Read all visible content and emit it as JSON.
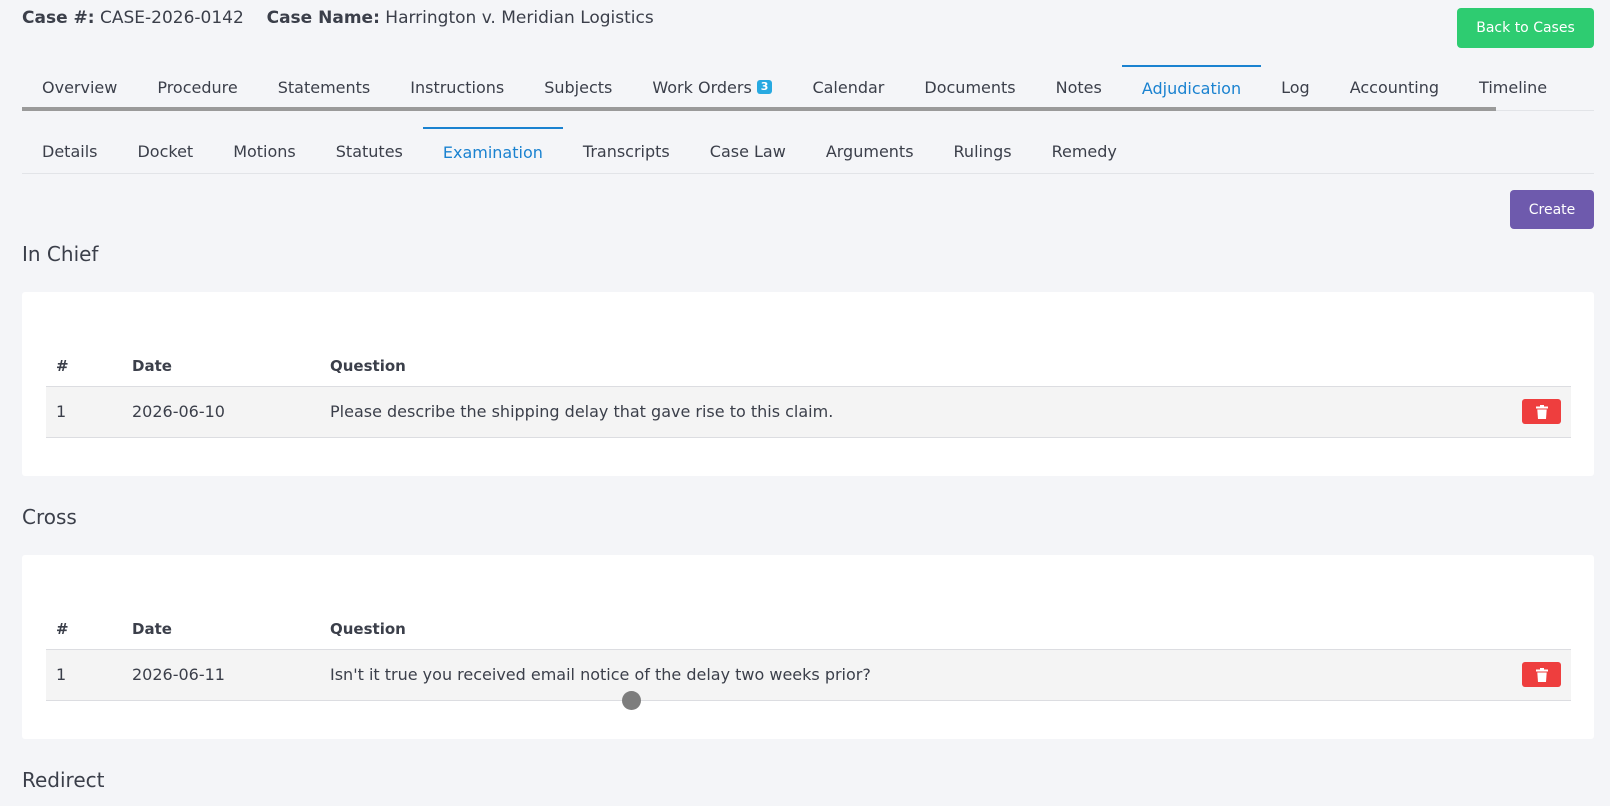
{
  "header": {
    "case_number_label": "Case #:",
    "case_number": "CASE-2026-0142",
    "case_name_label": "Case Name:",
    "case_name": "Harrington v. Meridian Logistics",
    "back_button": "Back to Cases"
  },
  "tabs": [
    {
      "label": "Overview"
    },
    {
      "label": "Procedure"
    },
    {
      "label": "Statements"
    },
    {
      "label": "Instructions"
    },
    {
      "label": "Subjects"
    },
    {
      "label": "Work Orders",
      "badge": "3"
    },
    {
      "label": "Calendar"
    },
    {
      "label": "Documents"
    },
    {
      "label": "Notes"
    },
    {
      "label": "Adjudication",
      "active": true
    },
    {
      "label": "Log"
    },
    {
      "label": "Accounting"
    },
    {
      "label": "Timeline"
    }
  ],
  "subtabs": [
    {
      "label": "Details"
    },
    {
      "label": "Docket"
    },
    {
      "label": "Motions"
    },
    {
      "label": "Statutes"
    },
    {
      "label": "Examination",
      "active": true
    },
    {
      "label": "Transcripts"
    },
    {
      "label": "Case Law"
    },
    {
      "label": "Arguments"
    },
    {
      "label": "Rulings"
    },
    {
      "label": "Remedy"
    }
  ],
  "create_button": "Create",
  "columns": {
    "num": "#",
    "date": "Date",
    "question": "Question"
  },
  "sections": {
    "in_chief": {
      "title": "In Chief",
      "rows": [
        {
          "num": "1",
          "date": "2026-06-10",
          "question": "Please describe the shipping delay that gave rise to this claim."
        }
      ]
    },
    "cross": {
      "title": "Cross",
      "rows": [
        {
          "num": "1",
          "date": "2026-06-11",
          "question": "Isn't it true you received email notice of the delay two weeks prior?"
        }
      ]
    },
    "redirect": {
      "title": "Redirect"
    }
  },
  "colors": {
    "accent": "#1a82d0",
    "success": "#2ecc71",
    "primary": "#6e5aad",
    "danger": "#ee3e3e"
  },
  "icons": {
    "delete": "trash-icon"
  }
}
